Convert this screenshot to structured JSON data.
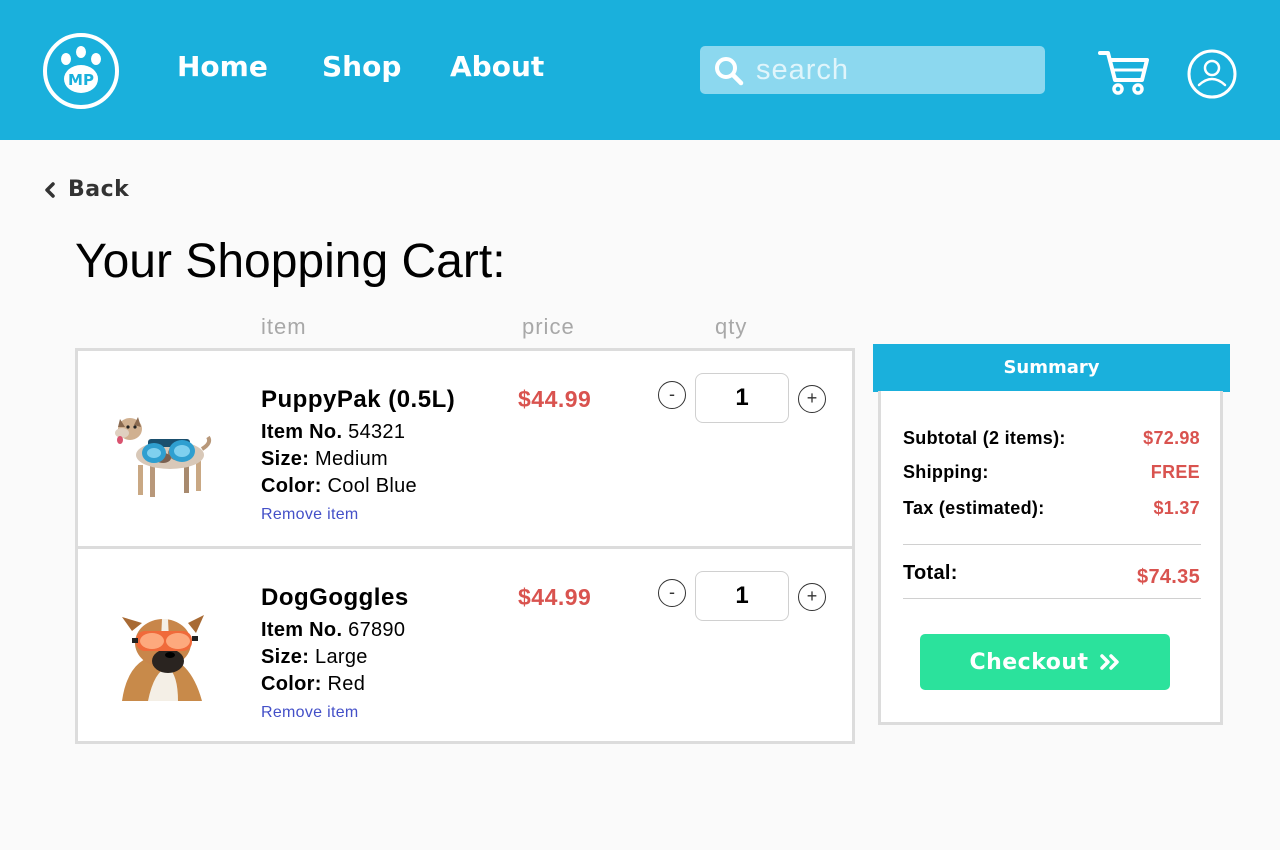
{
  "header": {
    "logo_text": "MP",
    "nav": [
      {
        "label": "Home"
      },
      {
        "label": "Shop"
      },
      {
        "label": "About"
      }
    ],
    "search_placeholder": "search"
  },
  "back_label": "Back",
  "page_title": "Your Shopping Cart:",
  "columns": {
    "item": "item",
    "price": "price",
    "qty": "qty"
  },
  "items": [
    {
      "name": "PuppyPak (0.5L)",
      "item_no_label": "Item No.",
      "item_no": "54321",
      "size_label": "Size:",
      "size": "Medium",
      "color_label": "Color:",
      "color": "Cool Blue",
      "remove_label": "Remove item",
      "price": "$44.99",
      "qty": "1",
      "image_icon": "dog-with-backpack-image"
    },
    {
      "name": "DogGoggles",
      "item_no_label": "Item No.",
      "item_no": "67890",
      "size_label": "Size:",
      "size": "Large",
      "color_label": "Color:",
      "color": "Red",
      "remove_label": "Remove item",
      "price": "$44.99",
      "qty": "1",
      "image_icon": "dog-with-goggles-image"
    }
  ],
  "summary": {
    "title": "Summary",
    "subtotal_label": "Subtotal (2 items):",
    "subtotal": "$72.98",
    "shipping_label": "Shipping:",
    "shipping": "FREE",
    "tax_label": "Tax (estimated):",
    "tax": "$1.37",
    "total_label": "Total:",
    "total": "$74.35",
    "checkout_label": "Checkout"
  },
  "colors": {
    "brand": "#1ab0dc",
    "price": "#d9534f",
    "checkout": "#2be29c",
    "link": "#4450c8"
  },
  "qty_controls": {
    "minus": "-",
    "plus": "+"
  }
}
